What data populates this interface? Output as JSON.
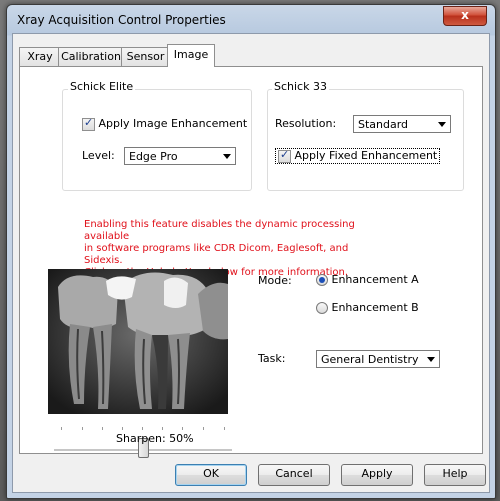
{
  "window": {
    "title": "Xray Acquisition Control Properties",
    "close_label": "x"
  },
  "tabs": [
    {
      "label": "Xray",
      "active": false
    },
    {
      "label": "Calibration",
      "active": false
    },
    {
      "label": "Sensor",
      "active": false
    },
    {
      "label": "Image",
      "active": true
    }
  ],
  "schick_elite": {
    "group_label": "Schick Elite",
    "apply_enhancement_label": "Apply Image Enhancement",
    "apply_enhancement_checked": true,
    "level_label": "Level:",
    "level_value": "Edge Pro"
  },
  "schick_33": {
    "group_label": "Schick 33",
    "resolution_label": "Resolution:",
    "resolution_value": "Standard",
    "apply_fixed_label": "Apply Fixed Enhancement",
    "apply_fixed_checked": true
  },
  "warning": {
    "line1": "Enabling this feature disables the dynamic processing available",
    "line2": "in software programs like CDR Dicom, Eaglesoft, and Sidexis.",
    "line3": "Click on the Help button below for more information.",
    "color": "#e0101a"
  },
  "mode": {
    "label": "Mode:",
    "options": [
      {
        "label": "Enhancement A",
        "selected": true
      },
      {
        "label": "Enhancement B",
        "selected": false
      }
    ]
  },
  "task": {
    "label": "Task:",
    "value": "General Dentistry"
  },
  "sharpen": {
    "label": "Sharpen: 50%",
    "value_percent": 50
  },
  "buttons": {
    "ok": "OK",
    "cancel": "Cancel",
    "apply": "Apply",
    "help": "Help"
  }
}
